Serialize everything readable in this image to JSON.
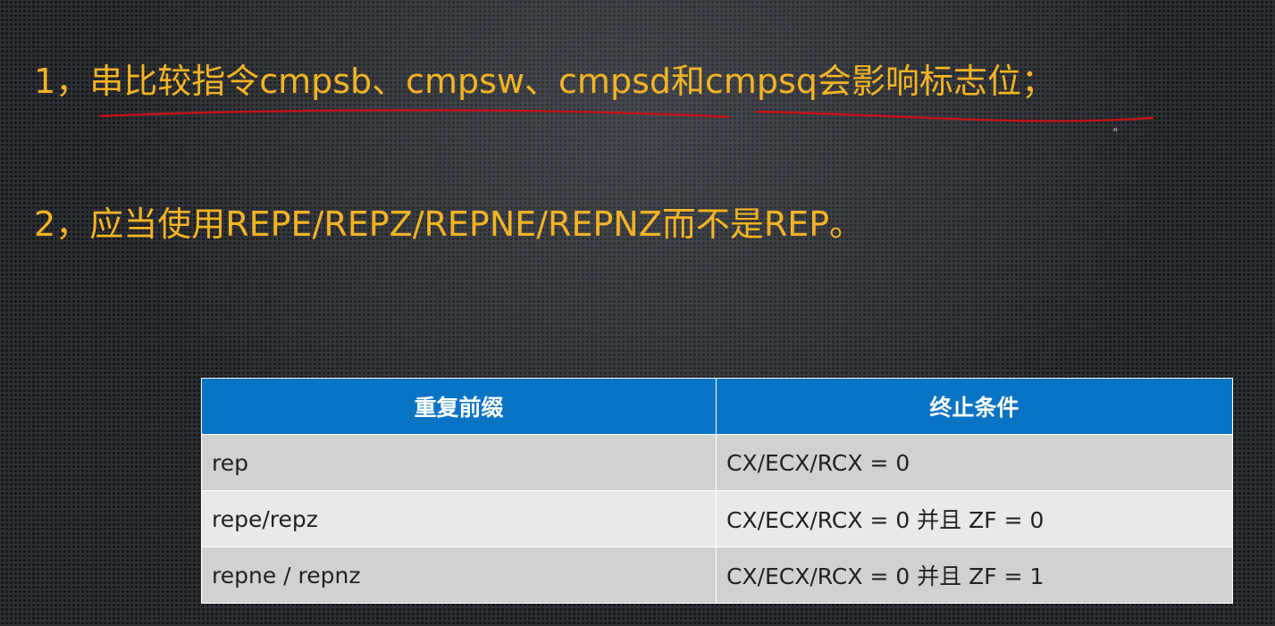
{
  "slide": {
    "point1": {
      "num": "1，",
      "text": "串比较指令cmpsb、cmpsw、cmpsd和cmpsq会影响标志位；"
    },
    "point2": {
      "num": "2，",
      "text": "应当使用REPE/REPZ/REPNE/REPNZ而不是REP。"
    },
    "annotation_dot": "。",
    "colors": {
      "text": "#f4b424",
      "underline": "#c0141a",
      "table_header": "#0a74c4"
    }
  },
  "table": {
    "headers": [
      "重复前缀",
      "终止条件"
    ],
    "rows": [
      [
        "rep",
        "CX/ECX/RCX = 0"
      ],
      [
        "repe/repz",
        "CX/ECX/RCX = 0 并且 ZF = 0"
      ],
      [
        "repne / repnz",
        "CX/ECX/RCX = 0 并且 ZF = 1"
      ]
    ]
  }
}
